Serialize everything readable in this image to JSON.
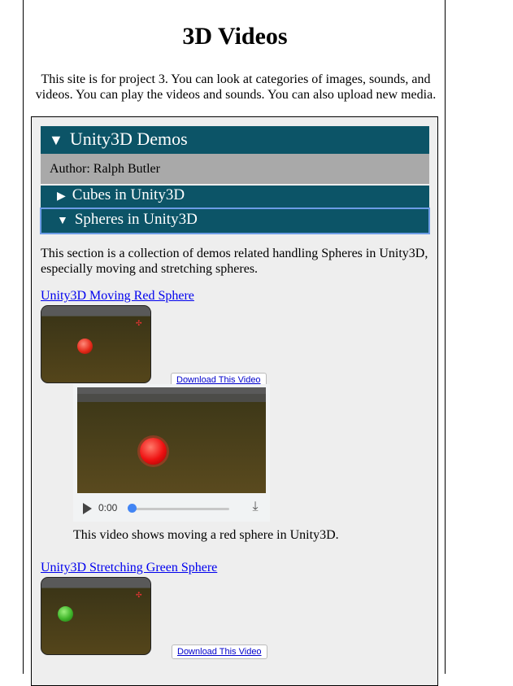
{
  "page": {
    "title": "3D Videos",
    "intro": "This site is for project 3. You can look at categories of images, sounds, and videos. You can play the videos and sounds. You can also upload new media."
  },
  "category": {
    "title": "Unity3D Demos",
    "expand_glyph": "▼",
    "author": "Author: Ralph Butler",
    "subsections": [
      {
        "title": "Cubes in Unity3D",
        "glyph": "▶",
        "expanded": false
      },
      {
        "title": "Spheres in Unity3D",
        "glyph": "▼",
        "expanded": true
      }
    ],
    "description": "This section is a collection of demos related handling Spheres in Unity3D, especially moving and stretching spheres."
  },
  "videos": [
    {
      "link_text": "Unity3D Moving Red Sphere",
      "download_label": "Download This Video",
      "ball_color": "#e52a1a",
      "player_time": "0:00",
      "caption": "This video shows moving a red sphere in Unity3D."
    },
    {
      "link_text": "Unity3D Stretching Green Sphere",
      "download_label": "Download This Video",
      "ball_color": "#3fb52a"
    }
  ],
  "colors": {
    "header_bar": "#0c5467",
    "author_bar": "#a9a9a9",
    "focus_outline": "#6c9ce6",
    "link": "#0000ee"
  }
}
